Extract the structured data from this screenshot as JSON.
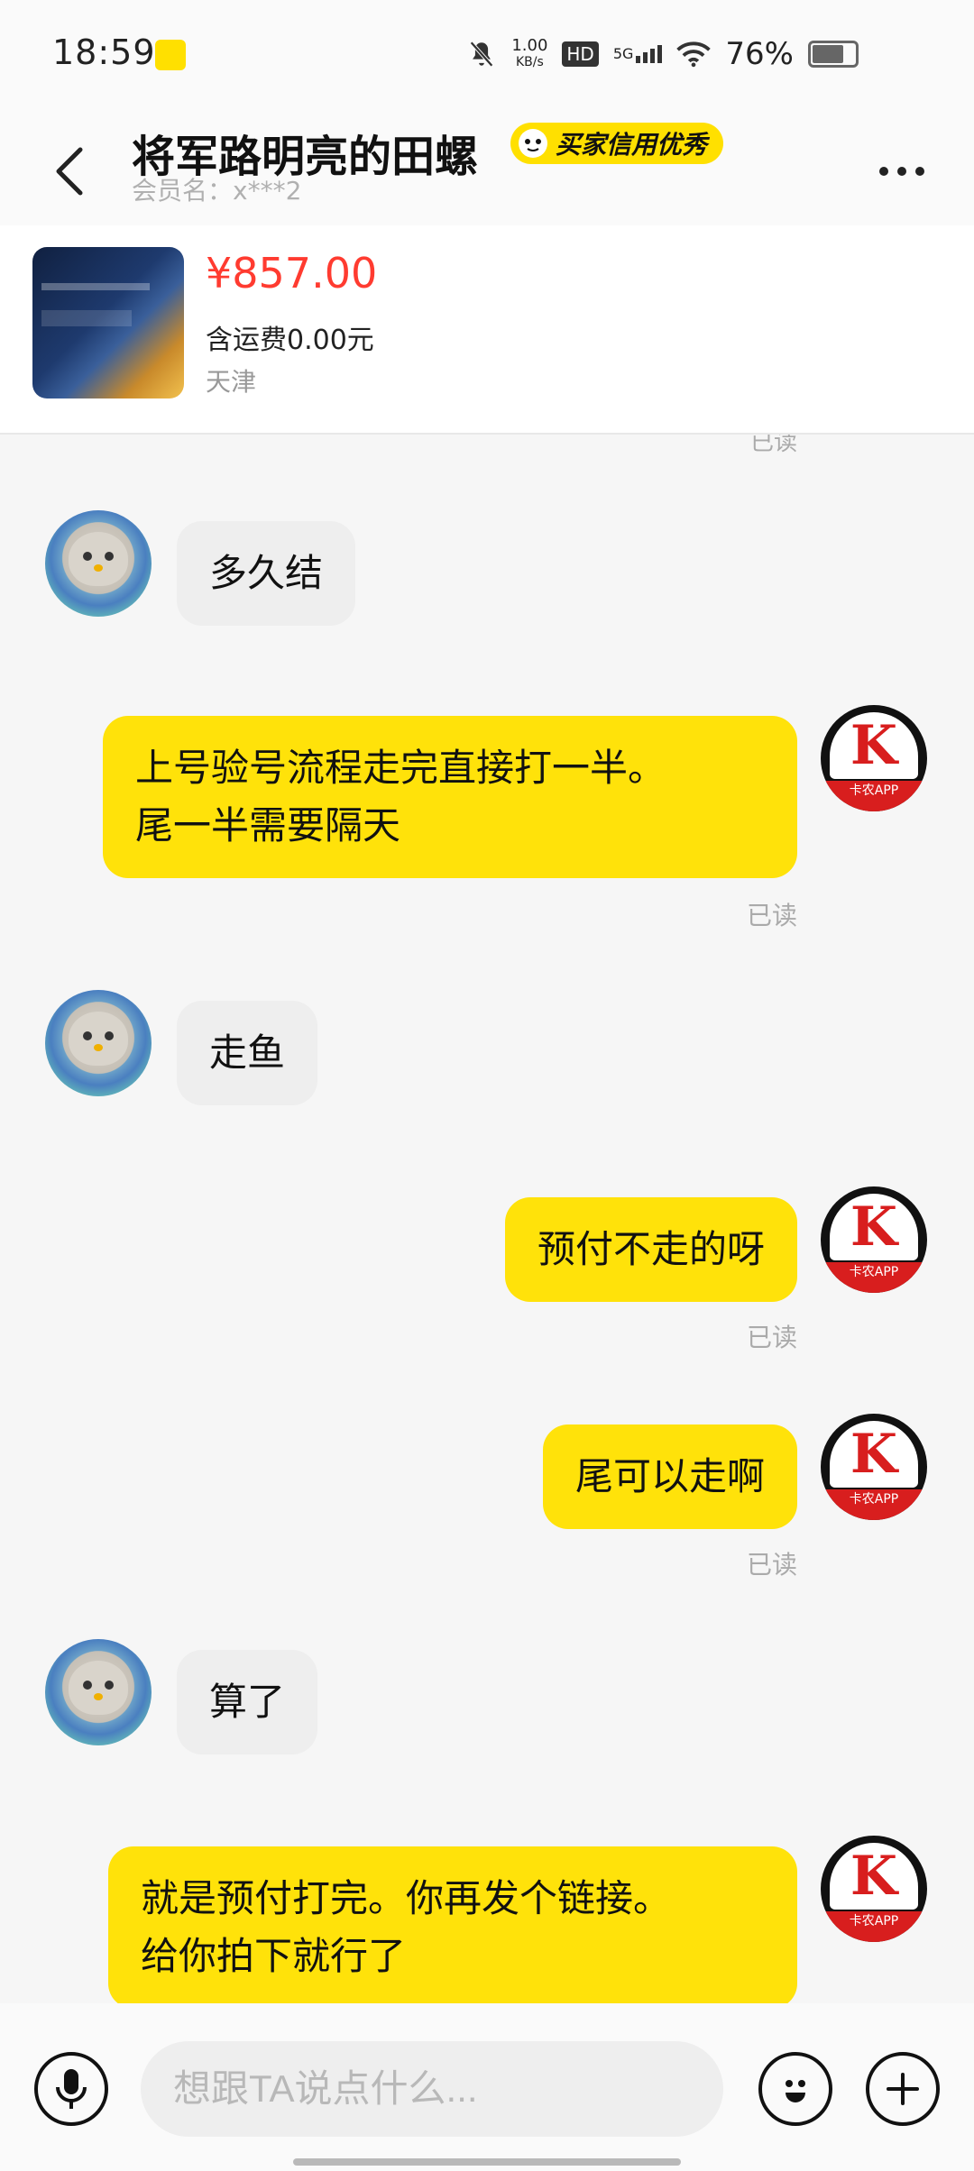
{
  "status_bar": {
    "time": "18:59",
    "net_speed_value": "1.00",
    "net_speed_unit": "KB/s",
    "hd": "HD",
    "network": "5G",
    "battery": "76%",
    "battery_level": 0.76
  },
  "header": {
    "title": "将军路明亮的田螺",
    "credit_badge": "买家信用优秀",
    "member": "会员名：x***2"
  },
  "product": {
    "price": "¥857.00",
    "shipping": "含运费0.00元",
    "location": "天津"
  },
  "chat": {
    "read_label_top": "已读",
    "messages": [
      {
        "side": "in",
        "text": "多久结"
      },
      {
        "side": "out",
        "text": "上号验号流程走完直接打一半。\n尾一半需要隔天",
        "read": "已读"
      },
      {
        "side": "in",
        "text": "走鱼"
      },
      {
        "side": "out",
        "text": "预付不走的呀",
        "read": "已读"
      },
      {
        "side": "out",
        "text": "尾可以走啊",
        "read": "已读"
      },
      {
        "side": "in",
        "text": "算了"
      },
      {
        "side": "out",
        "text": "就是预付打完。你再发个链接。\n给你拍下就行了"
      }
    ],
    "self_avatar_caption": "卡农APP"
  },
  "input": {
    "placeholder": "想跟TA说点什么..."
  },
  "icons": {
    "back": "back-arrow-icon",
    "more": "more-dots-icon",
    "mic": "microphone-icon",
    "emoji": "emoji-icon",
    "plus": "plus-icon"
  },
  "colors": {
    "accent_yellow": "#ffe20a",
    "price_red": "#ff3b30",
    "incoming_bubble": "#eeeeee"
  }
}
